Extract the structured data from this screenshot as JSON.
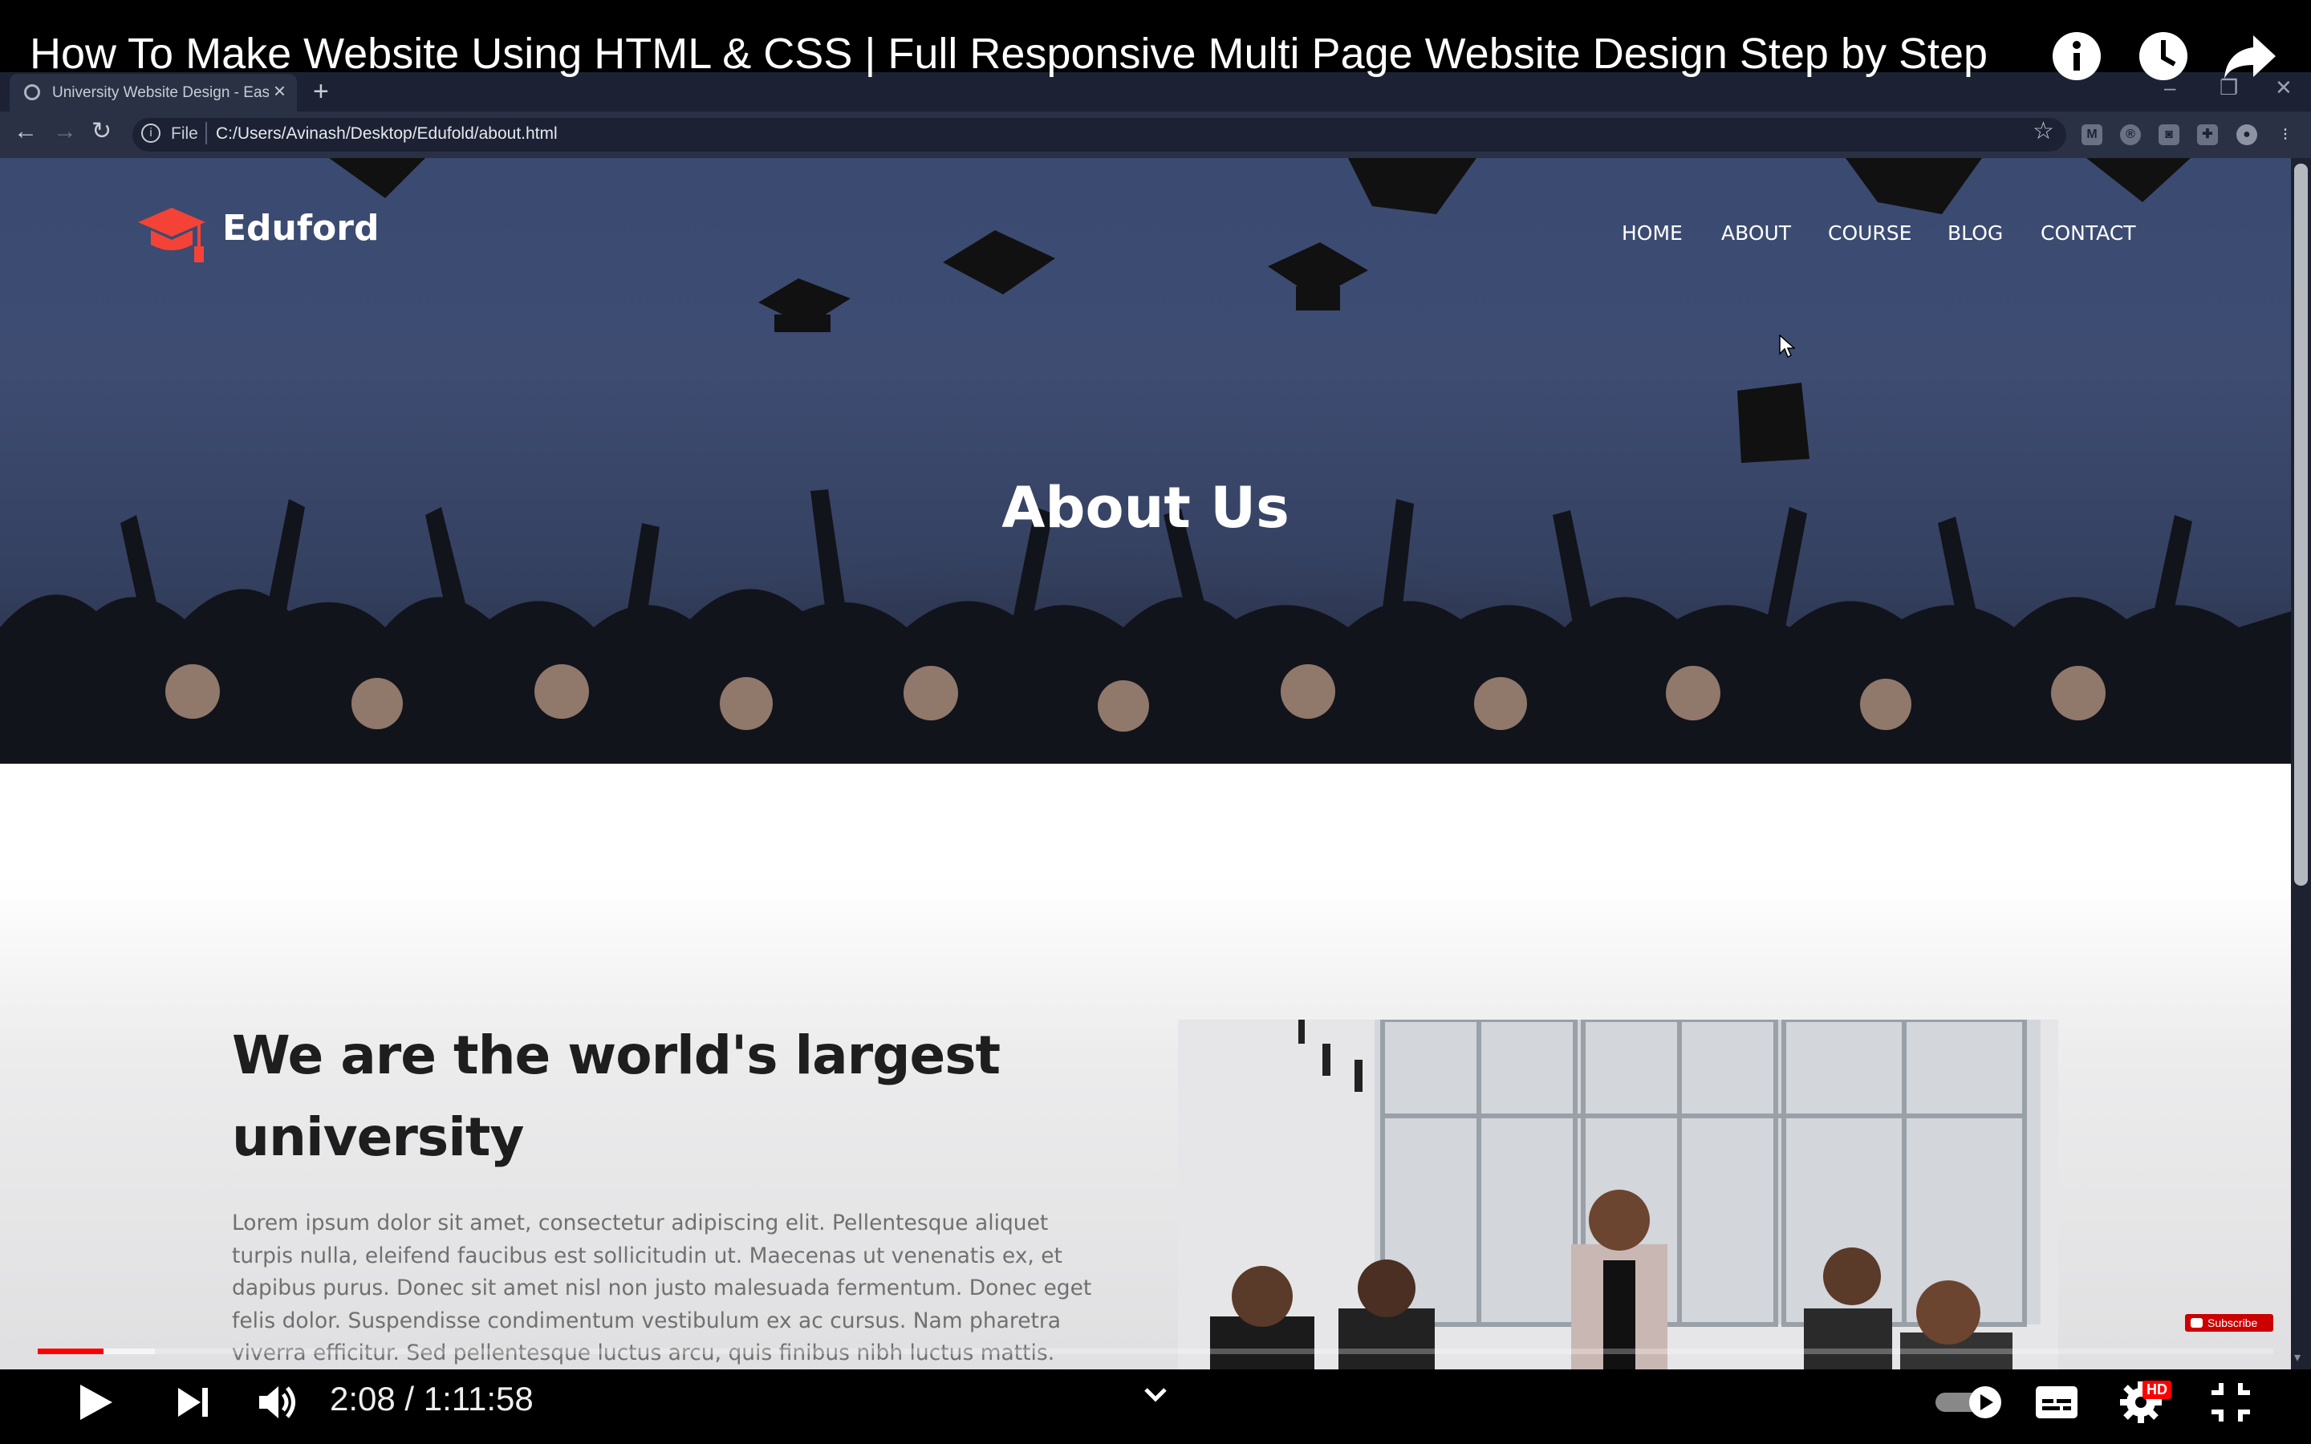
{
  "video": {
    "title": "How To Make Website Using HTML & CSS | Full Responsive Multi Page Website Design Step by Step",
    "time_current": "2:08",
    "time_total": "1:11:58",
    "progress_played": 0.0296,
    "progress_buffered": 0.0228,
    "subscribe_label": "Subscribe",
    "hd_badge": "HD"
  },
  "browser": {
    "tab_title": "University Website Design - Easy",
    "tab_close": "×",
    "new_tab": "+",
    "protocol_label": "File",
    "url": "C:/Users/Avinash/Desktop/Edufold/about.html"
  },
  "site": {
    "brand": "Eduford",
    "nav": [
      "HOME",
      "ABOUT",
      "COURSE",
      "BLOG",
      "CONTACT"
    ],
    "hero_title": "About Us",
    "about_heading_line1": "We are the world's largest",
    "about_heading_line2": "university",
    "about_text": "Lorem ipsum dolor sit amet, consectetur adipiscing elit. Pellentesque aliquet turpis nulla, eleifend faucibus est sollicitudin ut. Maecenas ut venenatis ex, et dapibus purus. Donec sit amet nisl non justo malesuada fermentum. Donec eget felis dolor. Suspendisse condimentum vestibulum ex ac cursus. Nam pharetra viverra efficitur. Sed pellentesque luctus arcu, quis finibus nibh luctus mattis.",
    "brand_color": "#f44336"
  }
}
